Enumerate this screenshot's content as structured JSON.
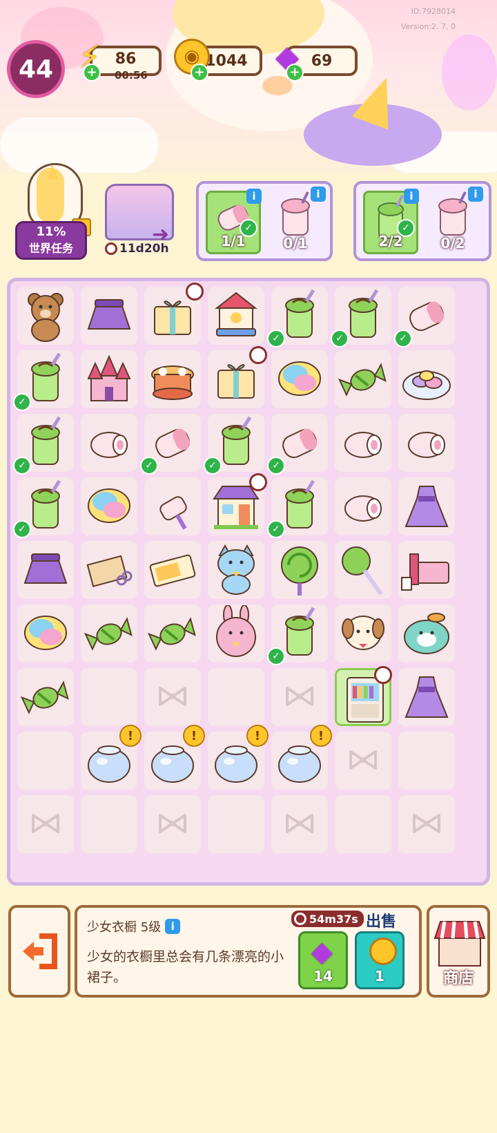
{
  "header": {
    "id_text": "ID:7928014",
    "version_text": "Version:2. 7. 0",
    "level": "44",
    "energy": "86",
    "energy_timer": "00:56",
    "coins": "1044",
    "gems": "69"
  },
  "world_task": {
    "percent": "11%",
    "label": "世界任务"
  },
  "event": {
    "timer": "11d20h"
  },
  "orders": [
    {
      "items": [
        {
          "name": "marshmallow",
          "count": "1/1",
          "done": true
        },
        {
          "name": "strawberry-smoothie",
          "count": "0/1",
          "done": false
        }
      ]
    },
    {
      "items": [
        {
          "name": "melon-soda",
          "count": "2/2",
          "done": true
        },
        {
          "name": "strawberry-smoothie",
          "count": "0/2",
          "done": false
        }
      ]
    }
  ],
  "board": {
    "rows": [
      [
        "teddy-bear",
        "purple-skirt",
        "gift-box-locked",
        "carousel",
        "melon-soda-check",
        "melon-soda-check",
        "marshmallow-check"
      ],
      [
        "melon-soda-check",
        "pink-castle",
        "mini-carousel",
        "gift-box-locked",
        "cotton-candy",
        "candy",
        "candy-plate"
      ],
      [
        "melon-soda-check",
        "roll-cake",
        "marshmallow-check",
        "melon-soda-check",
        "marshmallow-check",
        "roll-cake",
        "roll-cake"
      ],
      [
        "melon-soda-check",
        "cotton-candy",
        "lint-roller",
        "shop-building-locked",
        "melon-soda-check",
        "roll-cake",
        "purple-dress"
      ],
      [
        "purple-skirt",
        "sewing-kit",
        "ticket",
        "blue-cat",
        "green-lollipop",
        "green-lollipop-stick",
        "pink-bed"
      ],
      [
        "cotton-candy",
        "candy",
        "candy",
        "pink-bunny",
        "melon-soda-check",
        "puppy",
        "teal-seal"
      ],
      [
        "candy",
        "empty",
        "bow",
        "empty",
        "bow",
        "wardrobe-selected",
        "purple-dress"
      ],
      [
        "empty",
        "glass-jar-alert",
        "glass-jar-alert",
        "glass-jar-alert",
        "glass-jar-alert",
        "bow",
        "empty"
      ],
      [
        "bow",
        "empty",
        "bow",
        "empty",
        "bow",
        "empty",
        "bow"
      ]
    ]
  },
  "detail": {
    "title": "少女衣橱 5级",
    "description": "少女的衣橱里总会有几条漂亮的小裙子。",
    "sell_timer": "54m37s",
    "sell_label": "出售",
    "gem_price": "14",
    "coin_price": "1"
  },
  "shop": {
    "label": "商店"
  },
  "colors": {
    "accent_green": "#7ed348",
    "accent_teal": "#2ccbc4",
    "board_border": "#d2b3e5"
  }
}
